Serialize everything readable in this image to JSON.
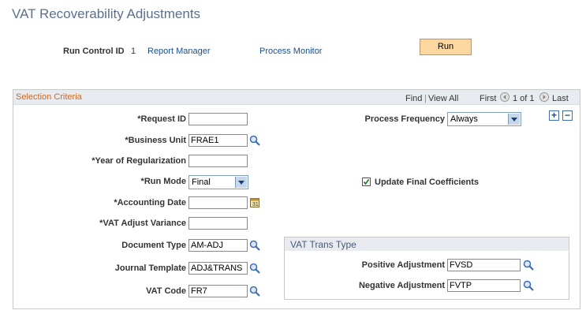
{
  "page": {
    "title": "VAT Recoverability Adjustments"
  },
  "run_control": {
    "label": "Run Control ID",
    "value": "1",
    "report_manager": "Report Manager",
    "process_monitor": "Process Monitor",
    "run_button": "Run"
  },
  "selection": {
    "title": "Selection Criteria",
    "find": "Find",
    "separator": "|",
    "view_all": "View All",
    "first": "First",
    "of": "1 of 1",
    "last": "Last",
    "add": "+",
    "remove": "−"
  },
  "fields": {
    "request_id": {
      "label": "*Request ID",
      "value": ""
    },
    "business_unit": {
      "label": "*Business Unit",
      "value": "FRAE1"
    },
    "year_of_regularization": {
      "label": "*Year of Regularization",
      "value": ""
    },
    "run_mode": {
      "label": "*Run Mode",
      "value": "Final"
    },
    "accounting_date": {
      "label": "*Accounting Date",
      "value": ""
    },
    "vat_adjust_variance": {
      "label": "*VAT Adjust Variance",
      "value": ""
    },
    "document_type": {
      "label": "Document Type",
      "value": "AM-ADJ"
    },
    "journal_template": {
      "label": "Journal Template",
      "value": "ADJ&TRANS"
    },
    "vat_code": {
      "label": "VAT Code",
      "value": "FR7"
    },
    "process_frequency": {
      "label": "Process Frequency",
      "value": "Always"
    },
    "update_final_coefficients": {
      "label": "Update Final Coefficients",
      "checked": true
    }
  },
  "vat_trans_type": {
    "title": "VAT Trans Type",
    "positive_adjustment": {
      "label": "Positive Adjustment",
      "value": "FVSD"
    },
    "negative_adjustment": {
      "label": "Negative Adjustment",
      "value": "FVTP"
    }
  },
  "icons": {
    "lookup": "magnifier-icon",
    "calendar": "calendar-icon",
    "dropdown": "chevron-down-icon",
    "checkbox": "check-icon",
    "first": "arrow-left-icon",
    "last": "arrow-right-icon"
  },
  "colors": {
    "title": "#5c6f8c",
    "link": "#1a4f8f",
    "section_title": "#c46a2b",
    "run_button": "#fcd8a0"
  }
}
